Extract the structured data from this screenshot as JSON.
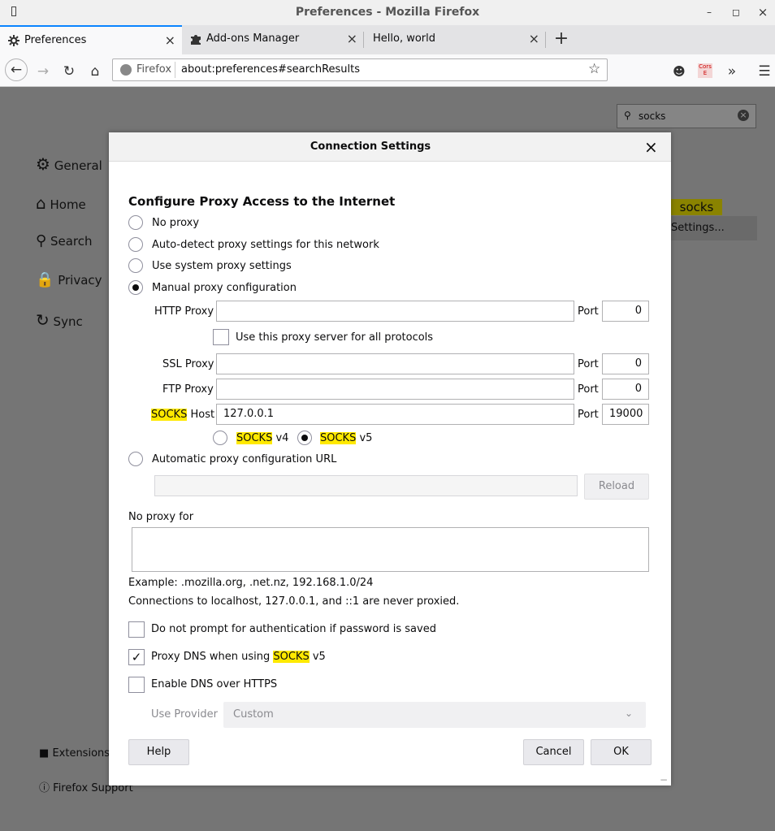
{
  "window": {
    "title": "Preferences - Mozilla Firefox"
  },
  "tabs": [
    {
      "label": "Preferences"
    },
    {
      "label": "Add-ons Manager"
    },
    {
      "label": "Hello, world"
    }
  ],
  "urlbar": {
    "identity": "Firefox",
    "url": "about:preferences#searchResults",
    "ext_badge": "Cors E"
  },
  "search": {
    "value": "socks"
  },
  "sidebar": {
    "items": [
      {
        "label": "General"
      },
      {
        "label": "Home"
      },
      {
        "label": "Search"
      },
      {
        "label": "Privacy"
      },
      {
        "label": "Sync"
      }
    ],
    "extensions": "Extensions",
    "support": "Firefox Support"
  },
  "background": {
    "highlight": "socks",
    "settings_button": "Settings..."
  },
  "dialog": {
    "title": "Connection Settings",
    "heading": "Configure Proxy Access to the Internet",
    "options": {
      "no_proxy": "No proxy",
      "auto_detect": "Auto-detect proxy settings for this network",
      "system": "Use system proxy settings",
      "manual": "Manual proxy configuration",
      "auto_url": "Automatic proxy configuration URL"
    },
    "selected": "manual",
    "http_proxy": {
      "label": "HTTP Proxy",
      "value": "",
      "port_label": "Port",
      "port": "0"
    },
    "use_all": {
      "label": "Use this proxy server for all protocols",
      "checked": false
    },
    "ssl_proxy": {
      "label": "SSL Proxy",
      "value": "",
      "port_label": "Port",
      "port": "0"
    },
    "ftp_proxy": {
      "label": "FTP Proxy",
      "value": "",
      "port_label": "Port",
      "port": "0"
    },
    "socks_host": {
      "label_hl": "SOCKS",
      "label_rest": "Host",
      "value": "127.0.0.1",
      "port_label": "Port",
      "port": "19000"
    },
    "socks_v4": {
      "hl": "SOCKS",
      "rest": "v4",
      "checked": false
    },
    "socks_v5": {
      "hl": "SOCKS",
      "rest": "v5",
      "checked": true
    },
    "auto_url_value": "",
    "reload_label": "Reload",
    "no_proxy_for": {
      "label": "No proxy for",
      "value": ""
    },
    "example": "Example: .mozilla.org, .net.nz, 192.168.1.0/24",
    "localhost_note": "Connections to localhost, 127.0.0.1, and ::1 are never proxied.",
    "no_prompt": {
      "label": "Do not prompt for authentication if password is saved",
      "checked": false
    },
    "proxy_dns": {
      "label_pre": "Proxy DNS when using",
      "hl": "SOCKS",
      "label_post": "v5",
      "checked": true
    },
    "dns_https": {
      "label": "Enable DNS over HTTPS",
      "checked": false
    },
    "provider": {
      "label": "Use Provider",
      "value": "Custom"
    },
    "buttons": {
      "help": "Help",
      "cancel": "Cancel",
      "ok": "OK"
    }
  },
  "colors": {
    "accent": "#0a84ff",
    "highlight": "#ffe900",
    "overlay": "#757575"
  }
}
